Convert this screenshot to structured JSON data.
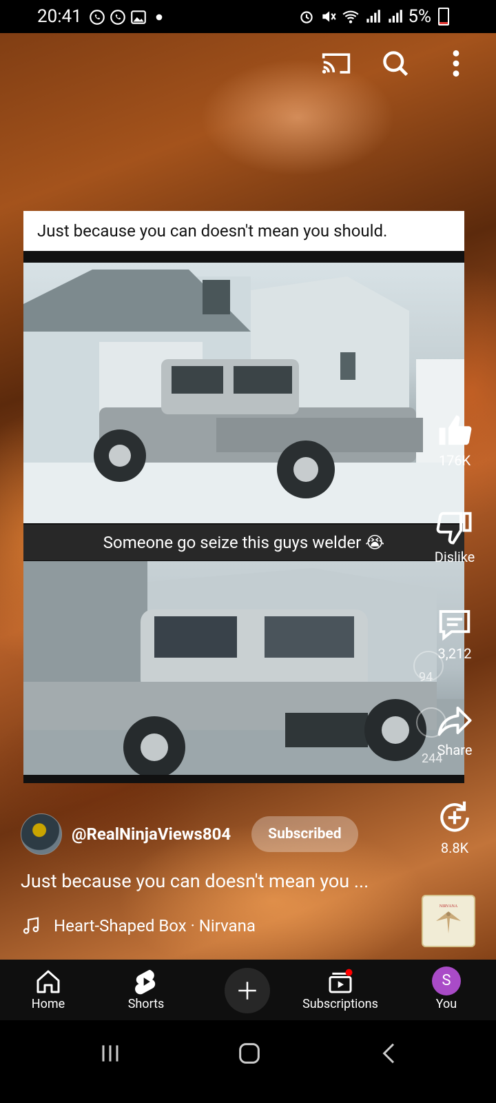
{
  "status_bar": {
    "time": "20:41",
    "battery": "5%"
  },
  "video": {
    "top_caption": "Just because you can doesn't mean you should.",
    "mid_caption": "Someone go seize this guys welder 😭"
  },
  "actions": {
    "like_count": "176K",
    "dislike_label": "Dislike",
    "comment_count": "3,212",
    "share_label": "Share",
    "remix_count": "8.8K",
    "overlay_like_count": "94",
    "overlay_share_count": "244"
  },
  "channel": {
    "handle": "@RealNinjaViews804",
    "subscribe_label": "Subscribed"
  },
  "title": "Just because you can doesn't mean you ...",
  "music": {
    "track": "Heart-Shaped Box · Nirvana",
    "album_text": "NIRVANA"
  },
  "nav": {
    "home": "Home",
    "shorts": "Shorts",
    "subscriptions": "Subscriptions",
    "you": "You",
    "you_initial": "S"
  },
  "colors": {
    "accent_red": "#ff0000",
    "avatar_purple": "#a94bc7"
  }
}
